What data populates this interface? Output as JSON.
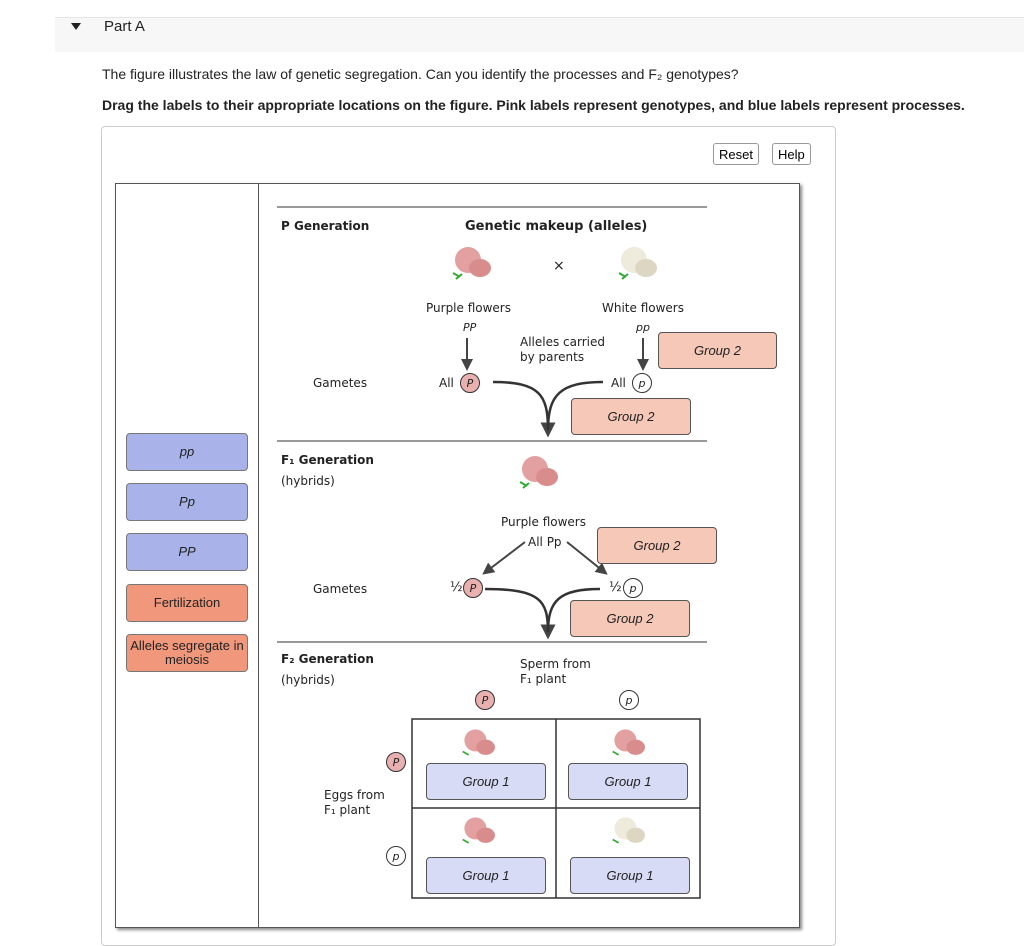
{
  "part": {
    "title": "Part A"
  },
  "question": "The figure illustrates the law of genetic segregation. Can you identify the processes and F₂ genotypes?",
  "instructions": "Drag the labels to their appropriate locations on the figure. Pink labels represent genotypes, and blue labels represent processes.",
  "toolbar": {
    "reset": "Reset",
    "help": "Help"
  },
  "labels": [
    {
      "text": "pp",
      "type": "genotype"
    },
    {
      "text": "Pp",
      "type": "genotype"
    },
    {
      "text": "PP",
      "type": "genotype"
    },
    {
      "text": "Fertilization",
      "type": "process"
    },
    {
      "text": "Alleles segregate in meiosis",
      "type": "process"
    }
  ],
  "figure": {
    "p_generation": "P Generation",
    "genetic_makeup": "Genetic makeup (alleles)",
    "cross": "×",
    "purple_flowers": "Purple flowers",
    "white_flowers": "White flowers",
    "PP": "PP",
    "pp": "pp",
    "alleles_carried_1": "Alleles carried",
    "alleles_carried_2": "by parents",
    "gametes": "Gametes",
    "all": "All",
    "P": "P",
    "p": "p",
    "f1_generation": "F₁ Generation",
    "hybrids": "(hybrids)",
    "all_pp": "All Pp",
    "half": "½",
    "f2_generation": "F₂ Generation",
    "sperm_1": "Sperm from",
    "sperm_2": "F₁ plant",
    "eggs_1": "Eggs from",
    "eggs_2": "F₁ plant",
    "group1": "Group 1",
    "group2": "Group 2"
  },
  "colors": {
    "genotype_label": "#a9b3ea",
    "process_label": "#f1987c",
    "group2_target": "#f5c8b8",
    "group1_target": "#d7dbf5"
  }
}
